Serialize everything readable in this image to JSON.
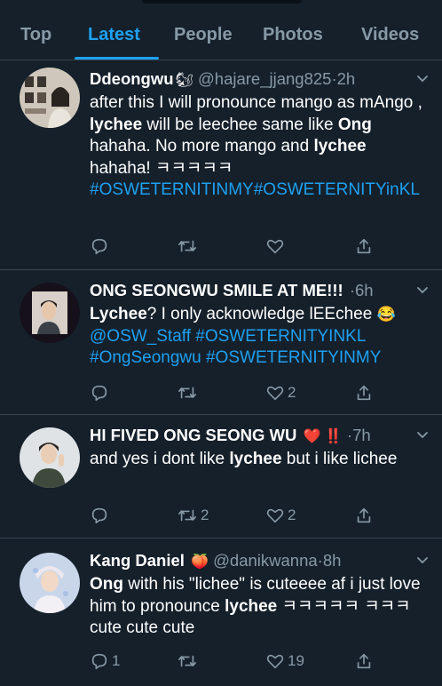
{
  "tabs": [
    "Top",
    "Latest",
    "People",
    "Photos",
    "Videos"
  ],
  "tweets": [
    {
      "name": "Ddeongwu",
      "name_emoji": "🐿",
      "handle": "@hajare_jjang825",
      "time": "2h",
      "body": [
        {
          "t": "after this I will pronounce mango as mAngo , "
        },
        {
          "t": "lychee",
          "b": true
        },
        {
          "t": " will be leechee same like "
        },
        {
          "t": "Ong",
          "b": true
        },
        {
          "t": " hahaha. No more mango and "
        },
        {
          "t": "lychee",
          "b": true
        },
        {
          "t": " hahaha! ㅋㅋㅋㅋㅋ "
        },
        {
          "t": "#OSWETERNITINMY",
          "tag": true,
          "br": true
        },
        {
          "t": "#OSWETERNITYinKL",
          "tag": true
        }
      ],
      "replies": "",
      "retweets": "",
      "likes": ""
    },
    {
      "name": "ONG SEONGWU SMILE AT ME!!!",
      "name_emoji": "",
      "handle": "",
      "time": "6h",
      "body": [
        {
          "t": "Lychee",
          "b": true
        },
        {
          "t": "? I only acknowledge lEEchee "
        },
        {
          "t": "😂",
          "emoji": true
        },
        {
          "t": " @OSW_Staff #OSWETERNITYINKL #OngSeongwu #OSWETERNITYINMY",
          "tag": true
        }
      ],
      "replies": "",
      "retweets": "",
      "likes": "2"
    },
    {
      "name": "HI FIVED ONG SEONG WU",
      "name_emoji": "❤️ ‼️",
      "handle": "",
      "time": "7h",
      "body": [
        {
          "t": "and yes i dont like "
        },
        {
          "t": "lychee",
          "b": true
        },
        {
          "t": " but i like lichee"
        }
      ],
      "replies": "",
      "retweets": "2",
      "likes": "2"
    },
    {
      "name": "Kang Daniel",
      "name_emoji": "🍑",
      "handle": "@danikwanna",
      "time": "8h",
      "body": [
        {
          "t": "Ong",
          "b": true
        },
        {
          "t": " with his \"lichee\" is cuteeee af i just love him to pronounce "
        },
        {
          "t": "lychee",
          "b": true
        },
        {
          "t": " ㅋㅋㅋㅋㅋ ㅋㅋㅋ cute cute cute"
        }
      ],
      "replies": "1",
      "retweets": "",
      "likes": "19"
    }
  ],
  "colors": {
    "background": "#15202b",
    "accent": "#1da1f2",
    "muted": "#8899a6",
    "divider": "#38444d"
  },
  "icons": {
    "reply": "reply-icon",
    "retweet": "retweet-icon",
    "like": "heart-icon",
    "share": "share-icon",
    "more": "chevron-down-icon"
  }
}
